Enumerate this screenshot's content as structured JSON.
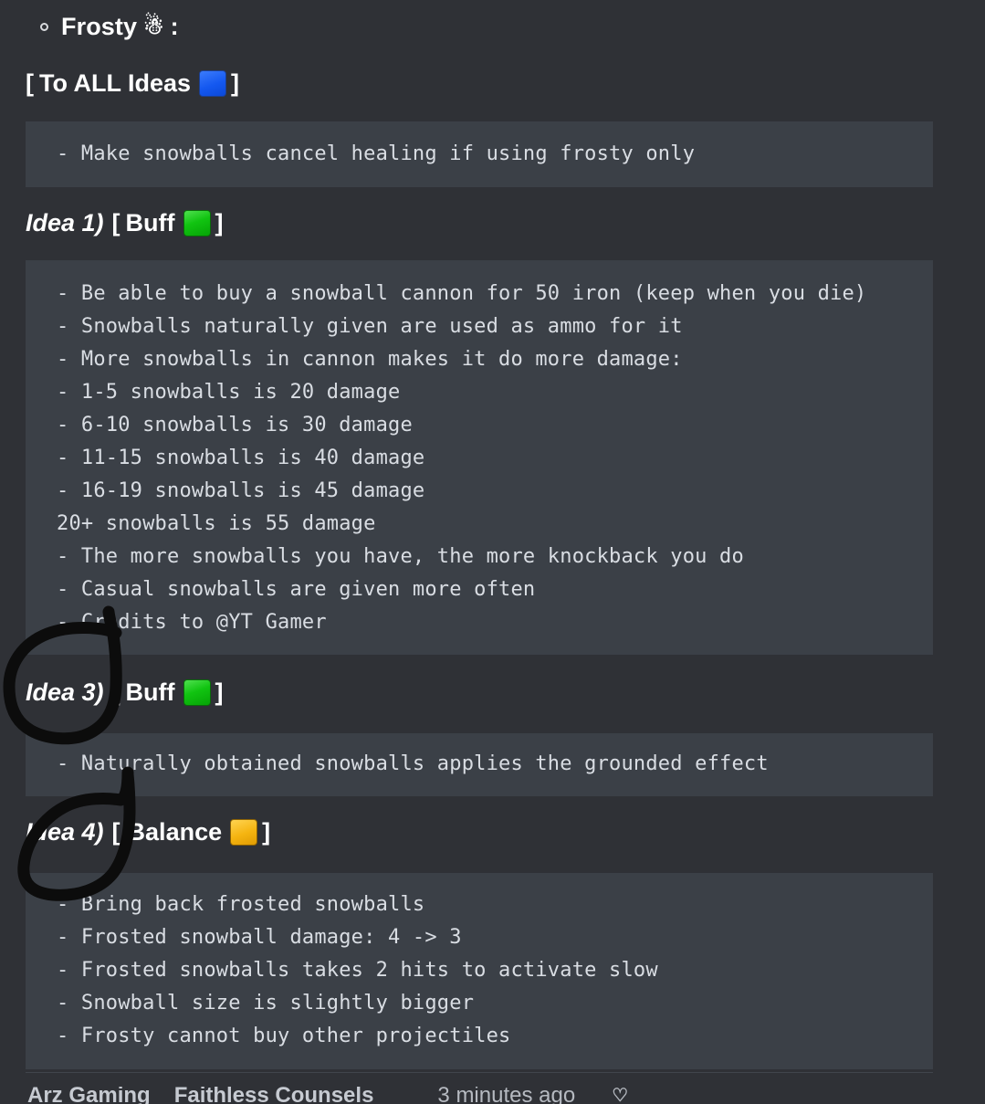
{
  "page": {
    "background_color": "#2f3136",
    "code_block_color": "#3b4047"
  },
  "header": {
    "bullet_label": "Frosty",
    "snowman_emoji": "☃",
    "colon": ":",
    "to_all_ideas": {
      "open_bracket": "[",
      "label": "To ALL Ideas",
      "badge_color": "#1458f0",
      "close_bracket": "]"
    }
  },
  "sections": [
    {
      "id": "to-all-ideas",
      "lines": [
        "- Make snowballs cancel healing if using frosty only"
      ]
    },
    {
      "id": "idea-1",
      "heading": {
        "label": "Idea 1)",
        "open_bracket": "[",
        "tag": "Buff",
        "badge_color": "#11c411",
        "close_bracket": "]"
      },
      "lines": [
        "- Be able to buy a snowball cannon for 50 iron (keep when you die)",
        "- Snowballs naturally given are used as ammo for it",
        "- More snowballs in cannon makes it do more damage:",
        "- 1-5 snowballs is 20 damage",
        "- 6-10 snowballs is 30 damage",
        "- 11-15 snowballs is 40 damage",
        "- 16-19 snowballs is 45 damage",
        "20+ snowballs is 55 damage",
        "- The more snowballs you have, the more knockback you do",
        "- Casual snowballs are given more often",
        "- Credits to @YT Gamer"
      ]
    },
    {
      "id": "idea-3",
      "heading": {
        "label": "Idea 3)",
        "open_bracket": "[",
        "tag": "Buff",
        "badge_color": "#11c411",
        "close_bracket": "]"
      },
      "lines": [
        "- Naturally obtained snowballs applies the grounded effect"
      ]
    },
    {
      "id": "idea-4",
      "heading": {
        "label": "Idea 4)",
        "open_bracket": "[",
        "tag": "Balance",
        "badge_color": "#f5b410",
        "close_bracket": "]"
      },
      "lines": [
        "- Bring back frosted snowballs",
        "- Frosted snowball damage: 4 -> 3",
        "- Frosted snowballs takes 2 hits to activate slow",
        "- Snowball size is slightly bigger",
        "- Frosty cannot buy other projectiles"
      ]
    }
  ],
  "footer": {
    "author": "Arz Gaming",
    "role": "Faithless Counsels",
    "timestamp": "3 minutes ago",
    "heart_icon": "♡"
  },
  "annotations": {
    "ink_color": "#0c0c0c",
    "circles": [
      {
        "name": "circle-around-idea-3",
        "target": "Idea 3)"
      },
      {
        "name": "circle-around-idea-4",
        "target": "Idea 4)"
      }
    ]
  }
}
